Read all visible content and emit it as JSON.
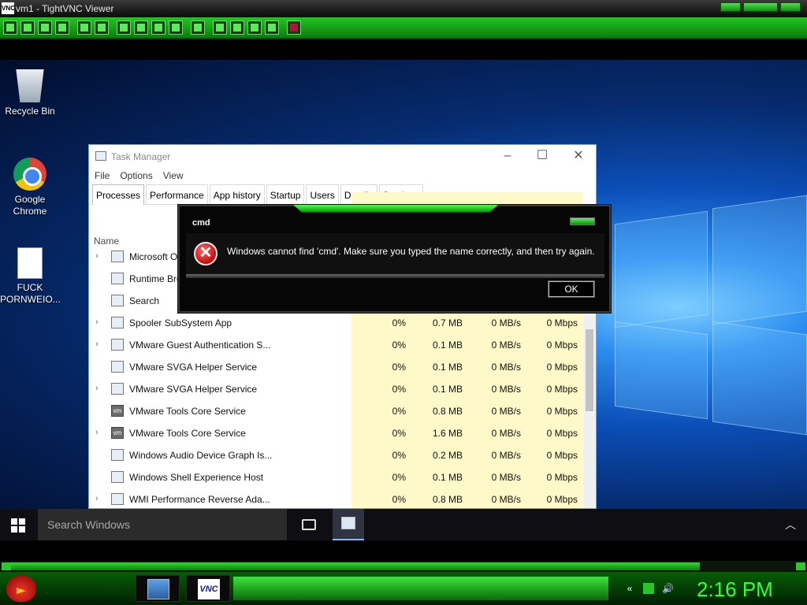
{
  "vnc": {
    "window_title": "vm1 - TightVNC Viewer",
    "logo": "VNC"
  },
  "desktop": {
    "icons": [
      {
        "label": "Recycle Bin",
        "icon": "recycle-bin-icon"
      },
      {
        "label": "Google Chrome",
        "icon": "chrome-icon"
      },
      {
        "label": "FUCK PORNWEIO...",
        "icon": "text-document-icon"
      }
    ]
  },
  "task_manager": {
    "title": "Task Manager",
    "menu": [
      "File",
      "Options",
      "View"
    ],
    "tabs": [
      "Processes",
      "Performance",
      "App history",
      "Startup",
      "Users",
      "Details",
      "Services"
    ],
    "active_tab": "Processes",
    "column_name": "Name",
    "rows": [
      {
        "name": "Microsoft O",
        "cpu": "",
        "memory": "",
        "disk": "",
        "network": "",
        "expand": true,
        "icon": "window-icon"
      },
      {
        "name": "Runtime Bro",
        "cpu": "",
        "memory": "",
        "disk": "",
        "network": "",
        "expand": false,
        "icon": "window-icon"
      },
      {
        "name": "Search",
        "cpu": "",
        "memory": "",
        "disk": "",
        "network": "",
        "expand": false,
        "icon": "search-icon"
      },
      {
        "name": "Spooler SubSystem App",
        "cpu": "0%",
        "memory": "0.7 MB",
        "disk": "0 MB/s",
        "network": "0 Mbps",
        "expand": true,
        "icon": "printer-icon"
      },
      {
        "name": "VMware Guest Authentication S...",
        "cpu": "0%",
        "memory": "0.1 MB",
        "disk": "0 MB/s",
        "network": "0 Mbps",
        "expand": true,
        "icon": "window-icon"
      },
      {
        "name": "VMware SVGA Helper Service",
        "cpu": "0%",
        "memory": "0.1 MB",
        "disk": "0 MB/s",
        "network": "0 Mbps",
        "expand": false,
        "icon": "window-icon"
      },
      {
        "name": "VMware SVGA Helper Service",
        "cpu": "0%",
        "memory": "0.1 MB",
        "disk": "0 MB/s",
        "network": "0 Mbps",
        "expand": true,
        "icon": "window-icon"
      },
      {
        "name": "VMware Tools Core Service",
        "cpu": "0%",
        "memory": "0.8 MB",
        "disk": "0 MB/s",
        "network": "0 Mbps",
        "expand": false,
        "icon": "vmware-icon"
      },
      {
        "name": "VMware Tools Core Service",
        "cpu": "0%",
        "memory": "1.6 MB",
        "disk": "0 MB/s",
        "network": "0 Mbps",
        "expand": true,
        "icon": "vmware-icon"
      },
      {
        "name": "Windows Audio Device Graph Is...",
        "cpu": "0%",
        "memory": "0.2 MB",
        "disk": "0 MB/s",
        "network": "0 Mbps",
        "expand": false,
        "icon": "window-icon"
      },
      {
        "name": "Windows Shell Experience Host",
        "cpu": "0%",
        "memory": "0.1 MB",
        "disk": "0 MB/s",
        "network": "0 Mbps",
        "expand": false,
        "icon": "window-icon"
      },
      {
        "name": "WMI Performance Reverse Ada...",
        "cpu": "0%",
        "memory": "0.8 MB",
        "disk": "0 MB/s",
        "network": "0 Mbps",
        "expand": true,
        "icon": "window-icon"
      }
    ]
  },
  "dialog": {
    "title": "cmd",
    "message": "Windows cannot find 'cmd'. Make sure you typed the name correctly, and then try again.",
    "ok_label": "OK"
  },
  "win_taskbar": {
    "search_placeholder": "Search Windows"
  },
  "host_taskbar": {
    "clock": "2:16 PM",
    "vnc_label": "VNC"
  },
  "colors": {
    "vnc_accent": "#1fc21f",
    "clock": "#37ff37",
    "cpu_column": "#fff8c8"
  }
}
